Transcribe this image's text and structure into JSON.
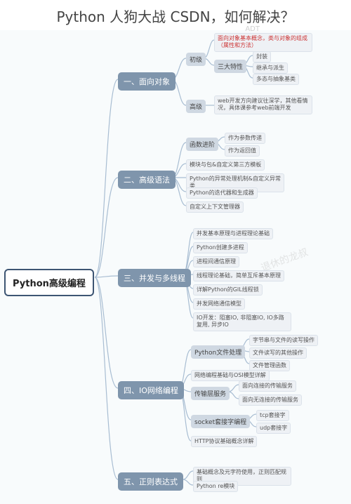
{
  "title": "Python 人狗大战 CSDN，如何解决？",
  "watermark1": "ADT",
  "watermark2": "退休的龙叔",
  "root": "Python高级编程",
  "b1": {
    "title": "一、面向对象",
    "items": {
      "s1": "初级",
      "s1a": "面向对象基本概念，类与对象的组成（属性和方法）",
      "s1b": "三大特性",
      "s1b1": "封装",
      "s1b2": "继承与派生",
      "s1b3": "多态与抽象基类",
      "s2": "高级",
      "s2a": "web开发方向建议往深学，其他看情况，具体课参考web前端开发"
    }
  },
  "b2": {
    "title": "二、高级语法",
    "items": {
      "s1": "函数进阶",
      "s1a": "作为参数传递",
      "s1b": "作为返回值",
      "s2": "模块与包&自定义第三方模板",
      "s3": "Python的异常处理机制&自定义异常类",
      "s4": "Python的迭代器和生成器",
      "s5": "自定义上下文管理器"
    }
  },
  "b3": {
    "title": "三、并发与多线程",
    "items": {
      "s1": "并发基本原理与进程理论基础",
      "s2": "Python创建多进程",
      "s3": "进程间通信原理",
      "s4": "线程理论基础，简单互斥基本原理",
      "s5": "详解Python的GIL线程锁",
      "s6": "并发网络通信模型",
      "s7": "IO开发：阻塞IO, 非阻塞IO, IO多路复用, 异步IO"
    }
  },
  "b4": {
    "title": "四、IO网络编程",
    "items": {
      "s1": "Python文件处理",
      "s1a": "字节串与文件的读写操作",
      "s1b": "文件读写的其他操作",
      "s1c": "文件管理函数",
      "s2": "网络编程基础与OSI模型详解",
      "s3": "传输层服务",
      "s3a": "面向连接的传输服务",
      "s3b": "面向无连接的传输服务",
      "s4": "socket套接字编程",
      "s4a": "tcp套接字",
      "s4b": "udp套接字",
      "s5": "HTTP协议基础概念详解"
    }
  },
  "b5": {
    "title": "五、正则表达式",
    "items": {
      "s1": "基础概念及元字符使用，正则匹配规则",
      "s2": "Python  re模块"
    }
  }
}
